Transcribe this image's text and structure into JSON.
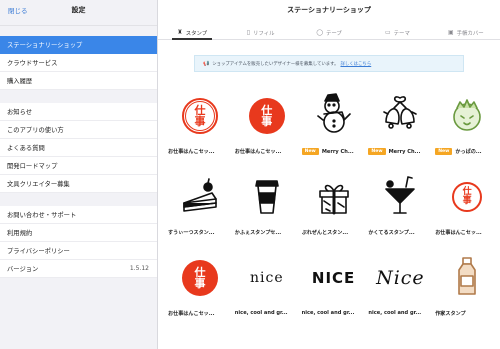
{
  "sidebar": {
    "close_label": "閉じる",
    "title": "設定",
    "groups": [
      [
        {
          "label": "ステーショナリーショップ",
          "active": true
        },
        {
          "label": "クラウドサービス"
        },
        {
          "label": "購入履歴"
        }
      ],
      [
        {
          "label": "お知らせ"
        },
        {
          "label": "このアプリの使い方"
        },
        {
          "label": "よくある質問"
        },
        {
          "label": "開発ロードマップ"
        },
        {
          "label": "文具クリエイター募集"
        }
      ],
      [
        {
          "label": "お問い合わせ・サポート"
        },
        {
          "label": "利用規約"
        },
        {
          "label": "プライバシーポリシー"
        },
        {
          "label": "バージョン",
          "value": "1.5.12"
        }
      ]
    ]
  },
  "main": {
    "title": "ステーショナリーショップ",
    "tabs": [
      {
        "label": "スタンプ",
        "icon": "stamp-icon",
        "glyph": "♜",
        "active": true
      },
      {
        "label": "リフィル",
        "icon": "refill-icon",
        "glyph": "▯"
      },
      {
        "label": "テープ",
        "icon": "tape-icon",
        "glyph": "◯"
      },
      {
        "label": "テーマ",
        "icon": "theme-icon",
        "glyph": "▭"
      },
      {
        "label": "手帳カバー",
        "icon": "notebook-cover-icon",
        "glyph": "▣"
      }
    ],
    "notice": {
      "text": "ショップアイテムを販売したいデザイナー様を募集しています。",
      "link": "詳しくはこちら"
    },
    "new_badge": "New",
    "items": [
      [
        {
          "name": "お仕事はんこセッ...",
          "art": "hanko-ring",
          "stamp_text": [
            "仕",
            "事"
          ]
        },
        {
          "name": "お仕事はんこセッ...",
          "art": "hanko-solid",
          "stamp_text": [
            "仕",
            "事"
          ]
        },
        {
          "name": "Merry Ch...",
          "art": "snowman",
          "new": true
        },
        {
          "name": "Merry Ch...",
          "art": "bells",
          "new": true
        },
        {
          "name": "かっぱの...",
          "art": "kappa",
          "new": true
        }
      ],
      [
        {
          "name": "すうぃーつスタン...",
          "art": "cake"
        },
        {
          "name": "かふぇスタンプセ...",
          "art": "coffee"
        },
        {
          "name": "ぷれぜんとスタン...",
          "art": "gift"
        },
        {
          "name": "かくてるスタンプ...",
          "art": "cocktail"
        },
        {
          "name": "お仕事はんこセッ...",
          "art": "hanko-ring-small",
          "stamp_text": [
            "仕",
            "事"
          ]
        }
      ],
      [
        {
          "name": "お仕事はんこセッ...",
          "art": "hanko-solid",
          "stamp_text": [
            "仕",
            "事"
          ]
        },
        {
          "name": "nice, cool and gr...",
          "art": "nice-serif",
          "word": "nice"
        },
        {
          "name": "nice, cool and gr...",
          "art": "nice-bold",
          "word": "NICE"
        },
        {
          "name": "nice, cool and gr...",
          "art": "nice-script",
          "word": "Nice"
        },
        {
          "name": "作家スタンプ",
          "art": "bottle"
        }
      ]
    ]
  }
}
